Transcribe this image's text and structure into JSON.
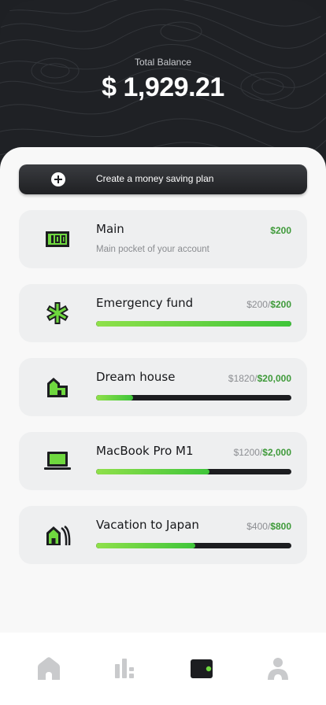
{
  "balance": {
    "label": "Total Balance",
    "value": "$ 1,929.21"
  },
  "create_plan": {
    "label": "Create a money saving plan",
    "icon": "plus-circle-icon"
  },
  "pockets": [
    {
      "icon": "banknote-icon",
      "title": "Main",
      "subtitle": "Main pocket of your account",
      "amount": "$200"
    },
    {
      "icon": "medical-star-icon",
      "title": "Emergency fund",
      "saved": "$200",
      "separator": "/",
      "target": "$200",
      "progress": 1.0
    },
    {
      "icon": "house-icon",
      "title": "Dream house",
      "saved": "$1820",
      "separator": "/",
      "target": "$20,000",
      "progress": 0.19
    },
    {
      "icon": "laptop-icon",
      "title": "MacBook Pro M1",
      "saved": "$1200",
      "separator": "/",
      "target": "$2,000",
      "progress": 0.58
    },
    {
      "icon": "building-icon",
      "title": "Vacation to Japan",
      "saved": "$400",
      "separator": "/",
      "target": "$800",
      "progress": 0.51
    }
  ],
  "tabs": [
    {
      "icon": "home-icon",
      "active": false
    },
    {
      "icon": "stats-icon",
      "active": false
    },
    {
      "icon": "wallet-icon",
      "active": true
    },
    {
      "icon": "profile-icon",
      "active": false
    }
  ],
  "colors": {
    "accent_green": "#3f9a3a",
    "bright_green": "#6fd83f",
    "dark": "#1f2125",
    "card_bg": "#eeeff0"
  }
}
